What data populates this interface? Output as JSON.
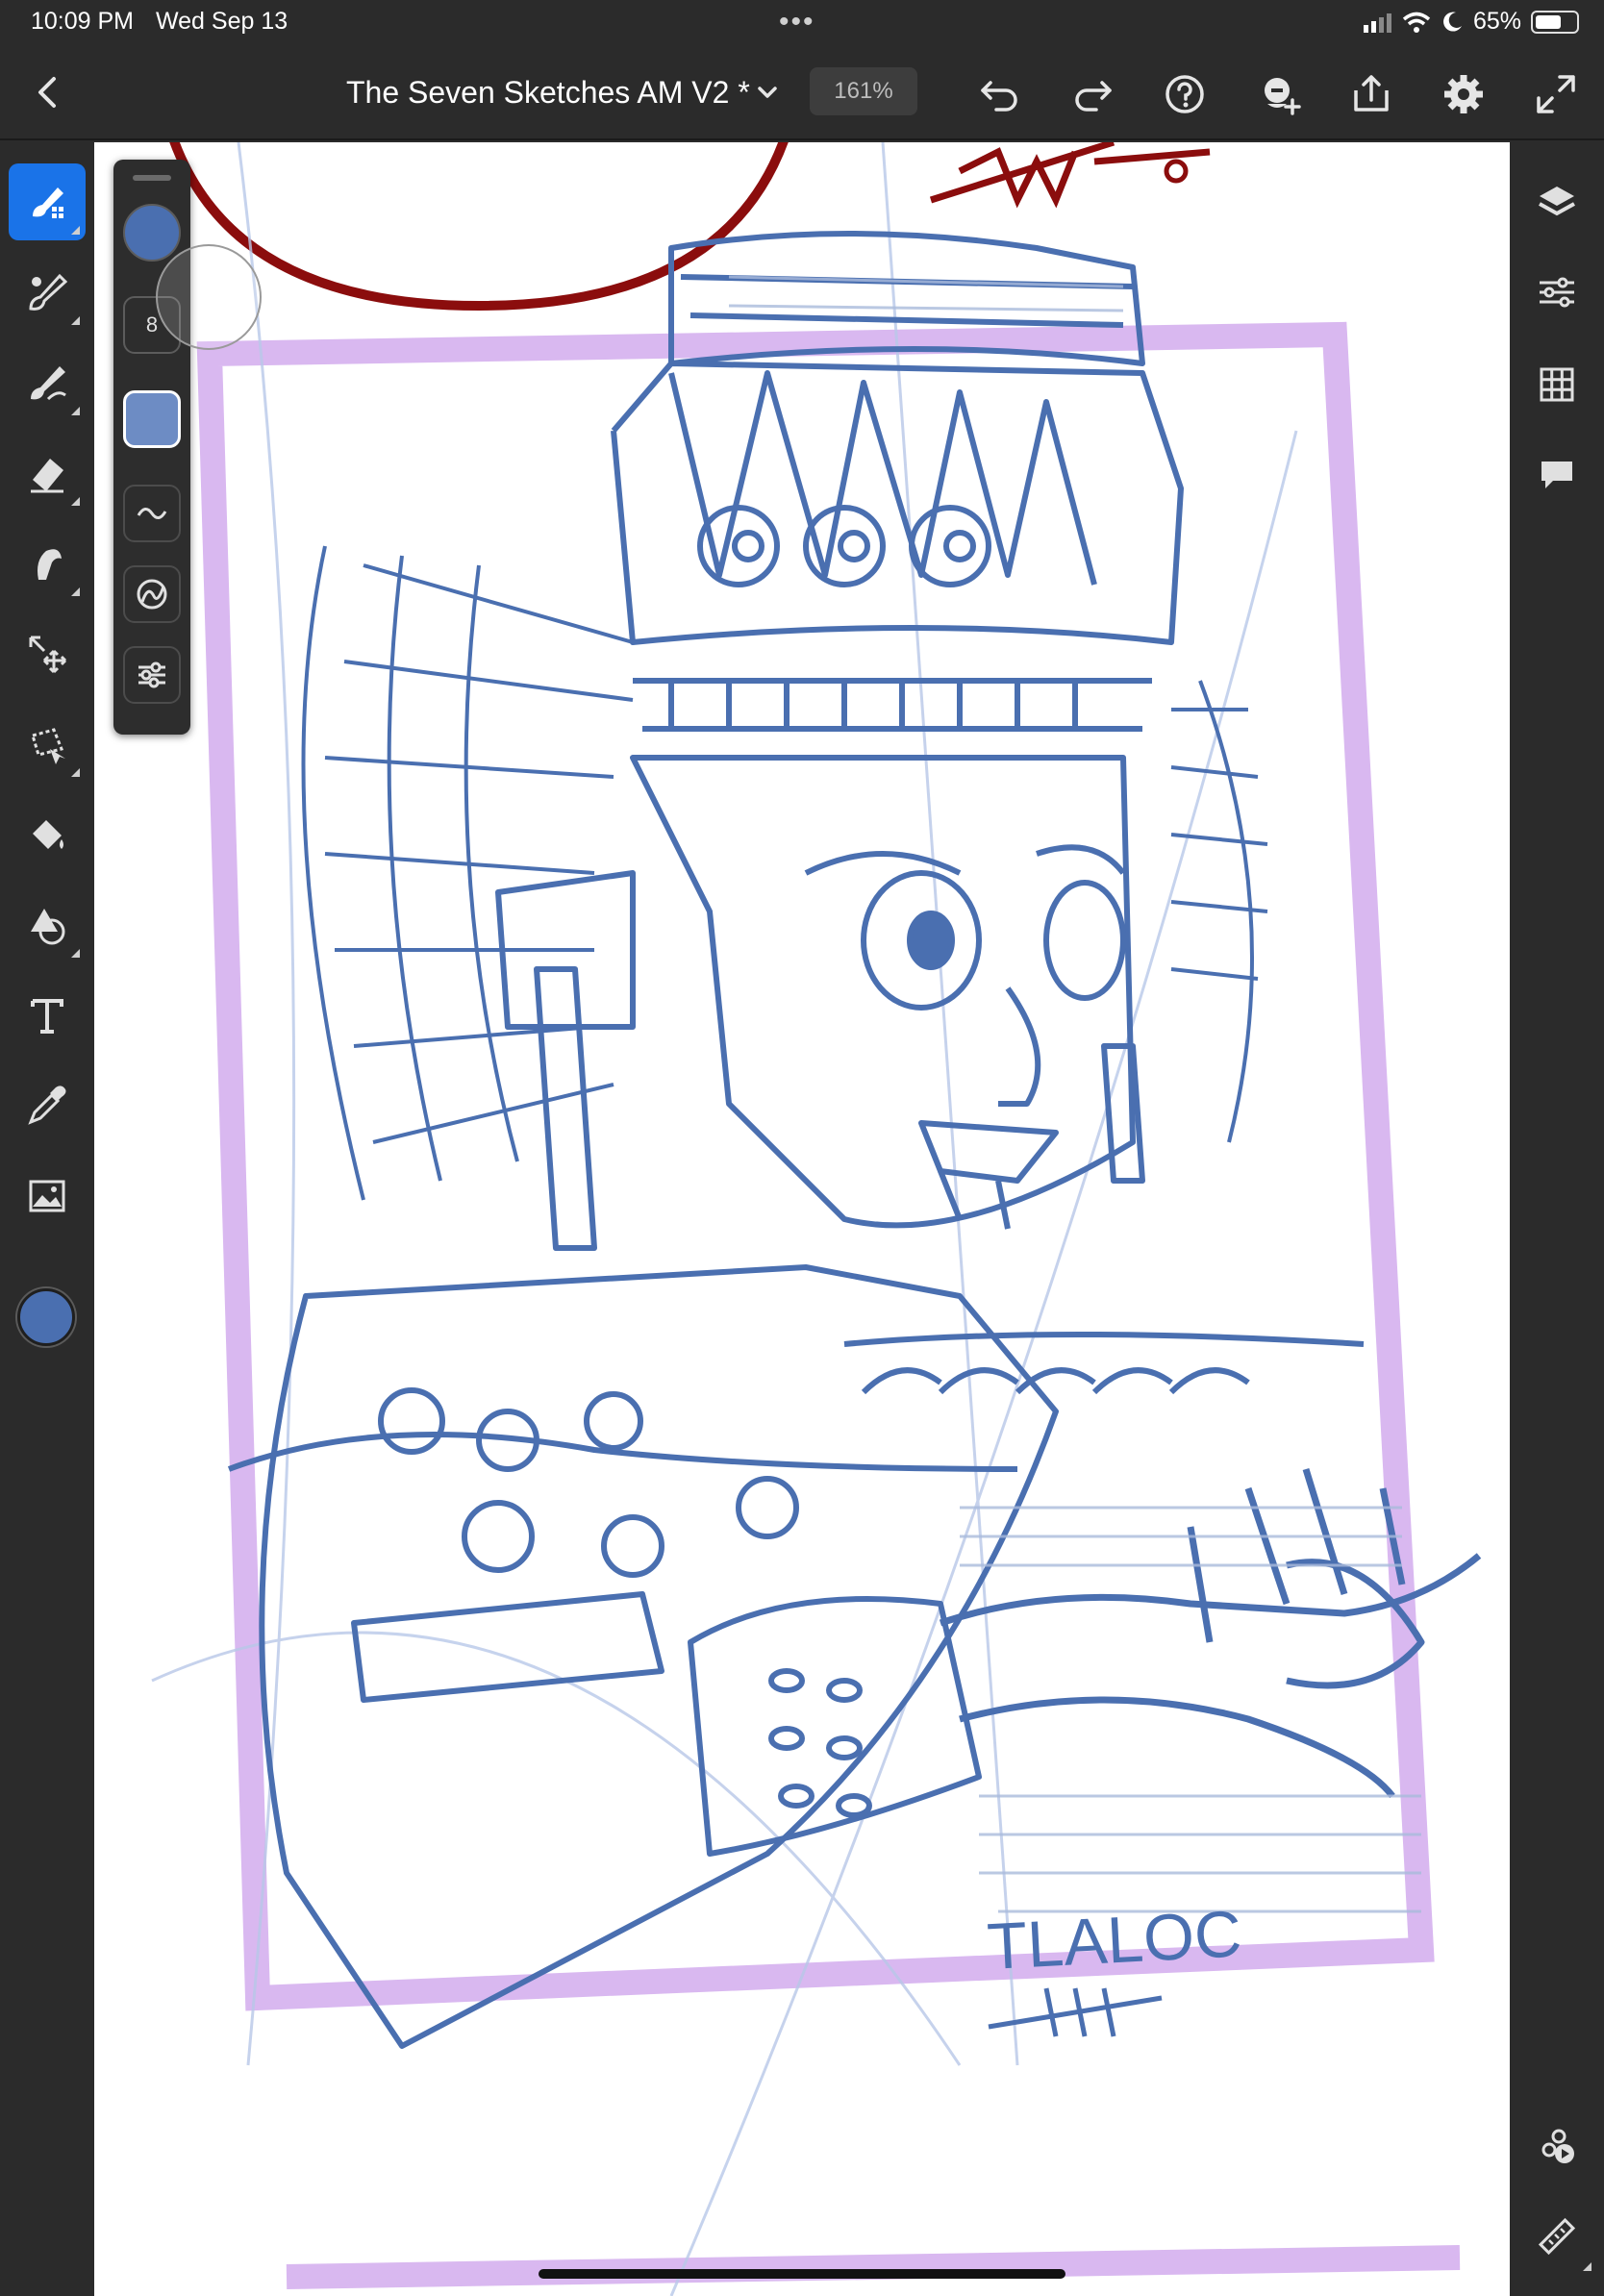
{
  "status": {
    "time": "10:09 PM",
    "date": "Wed Sep 13",
    "dots": "•••",
    "battery": "65%",
    "battery_level": 0.65
  },
  "toolbar": {
    "title": "The Seven Sketches AM V2 *",
    "zoom": "161%"
  },
  "brush_panel": {
    "size": "8",
    "color": "#4a6fb0"
  },
  "canvas": {
    "signature_text": "TLALOC"
  },
  "colors": {
    "accent": "#1a73e8",
    "sketch_blue": "#4a6fb0",
    "frame_purple": "#d9b8f0",
    "stamp_red": "#8b0d0d",
    "ui_dark": "#2b2b2b"
  },
  "icons": {
    "left_tools": [
      "pixel-brush-icon",
      "live-brush-icon",
      "vector-brush-icon",
      "eraser-icon",
      "smudge-icon",
      "transform-icon",
      "lasso-select-icon",
      "fill-icon",
      "shapes-icon",
      "text-icon",
      "eyedropper-icon",
      "image-icon"
    ],
    "right_tools": [
      "layers-icon",
      "adjustments-icon",
      "grid-icon",
      "comments-icon",
      "livestream-icon",
      "ruler-icon"
    ]
  }
}
